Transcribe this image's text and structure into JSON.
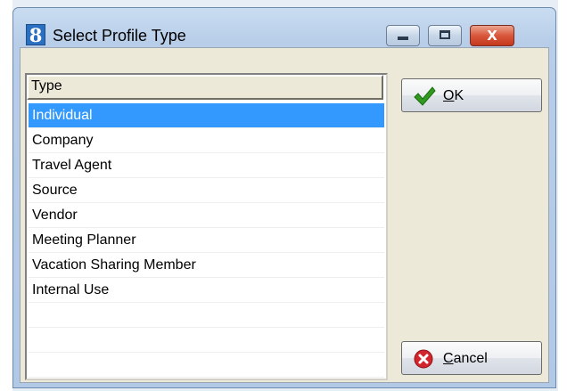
{
  "window": {
    "app_icon_glyph": "8",
    "title": "Select Profile Type",
    "minimize_glyph": "_",
    "maximize_glyph": "□",
    "close_glyph": "X"
  },
  "list": {
    "header": "Type",
    "items": [
      "Individual",
      "Company",
      "Travel Agent",
      "Source",
      "Vendor",
      "Meeting Planner",
      "Vacation Sharing Member",
      "Internal Use"
    ],
    "selected": "Individual"
  },
  "buttons": {
    "ok": {
      "mnemonic": "O",
      "rest": "K",
      "icon": "checkmark-icon"
    },
    "cancel": {
      "mnemonic": "C",
      "rest": "ancel",
      "icon": "cancel-x-icon"
    }
  },
  "colors": {
    "selection": "#3399ff",
    "titlebar": "#b7cde8",
    "close_button": "#d9573b",
    "ok_check": "#2f9a1e",
    "cancel_circle": "#d2252e"
  }
}
